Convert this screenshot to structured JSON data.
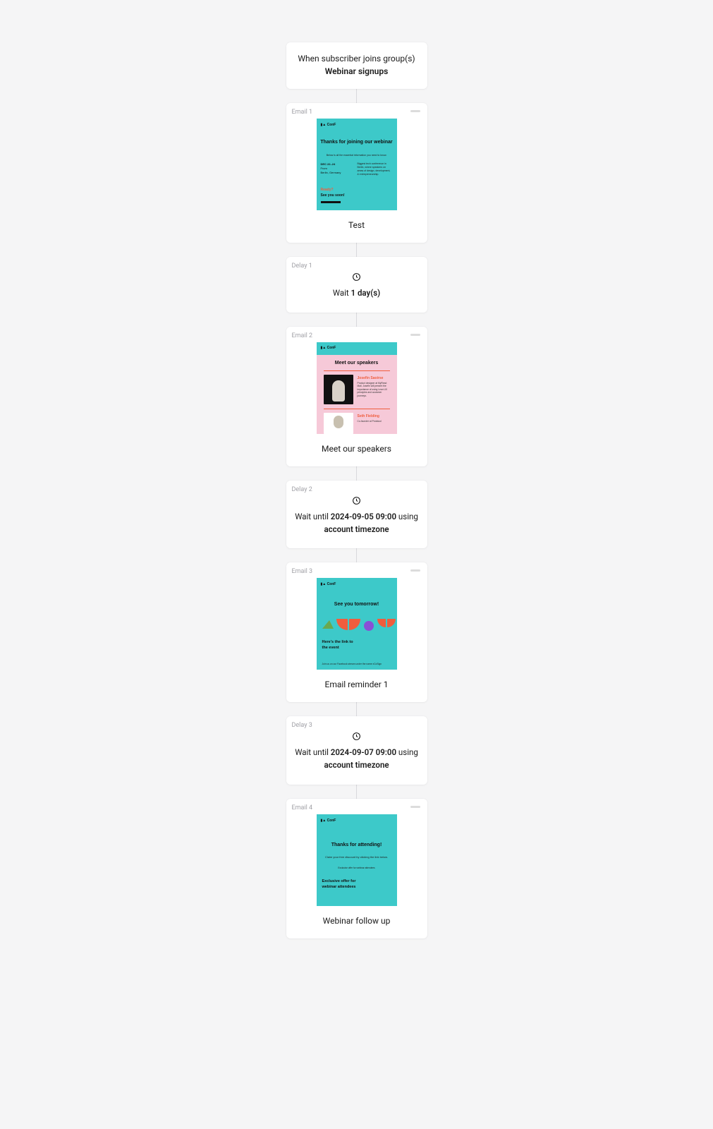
{
  "trigger": {
    "prefix": "When subscriber joins group(s) ",
    "group": "Webinar signups"
  },
  "steps": [
    {
      "type": "email",
      "label": "Email 1",
      "title": "Test",
      "thumb": {
        "logo": "▮▲ ConF",
        "headline": "Thanks for joining our webinar",
        "sub": "Below is all the essential information you need to know.",
        "date_label": "DEC 22–24",
        "from_label": "From",
        "location": "Berlin, Germany",
        "blurb": "Biggest tech conference in Berlin, where speakers on areas of design, development, & entrepreneurship.",
        "ready": "Ready?",
        "soon": "See you soon!"
      }
    },
    {
      "type": "delay",
      "label": "Delay 1",
      "text_prefix": "Wait ",
      "bold": "1 day(s)"
    },
    {
      "type": "email",
      "label": "Email 2",
      "title": "Meet our speakers",
      "thumb": {
        "logo": "▮▲ ConF",
        "headline": "Meet our speakers",
        "speaker1_name": "Josefin Saoirse",
        "speaker1_desc": "Product designer at MyRead Mail. Josefin will present the importance of using Lean UX principles and customer journeys.",
        "speaker2_name": "Seth Fielding",
        "speaker2_desc": "Co-founder at Prototool"
      }
    },
    {
      "type": "delay",
      "label": "Delay 2",
      "text_prefix": "Wait until ",
      "bold": "2024-09-05 09:00",
      "mid": " using ",
      "bold2": "account timezone"
    },
    {
      "type": "email",
      "label": "Email 3",
      "title": "Email reminder 1",
      "thumb": {
        "logo": "▮▲ ConF",
        "headline": "See you tomorrow!",
        "line1": "Here's the link to",
        "line2": "the event",
        "sub": "Join us on our Facebook stream under the name xCoSign"
      }
    },
    {
      "type": "delay",
      "label": "Delay 3",
      "text_prefix": "Wait until ",
      "bold": "2024-09-07 09:00",
      "mid": " using ",
      "bold2": "account timezone"
    },
    {
      "type": "email",
      "label": "Email 4",
      "title": "Webinar follow up",
      "thumb": {
        "logo": "▮▲ ConF",
        "headline": "Thanks for attending!",
        "sub": "Claim your free discount by clicking the link below.",
        "note": "Exclusive offer for webinar attendees",
        "line1": "Exclusive offer for",
        "line2": "webinar attendees"
      }
    }
  ]
}
